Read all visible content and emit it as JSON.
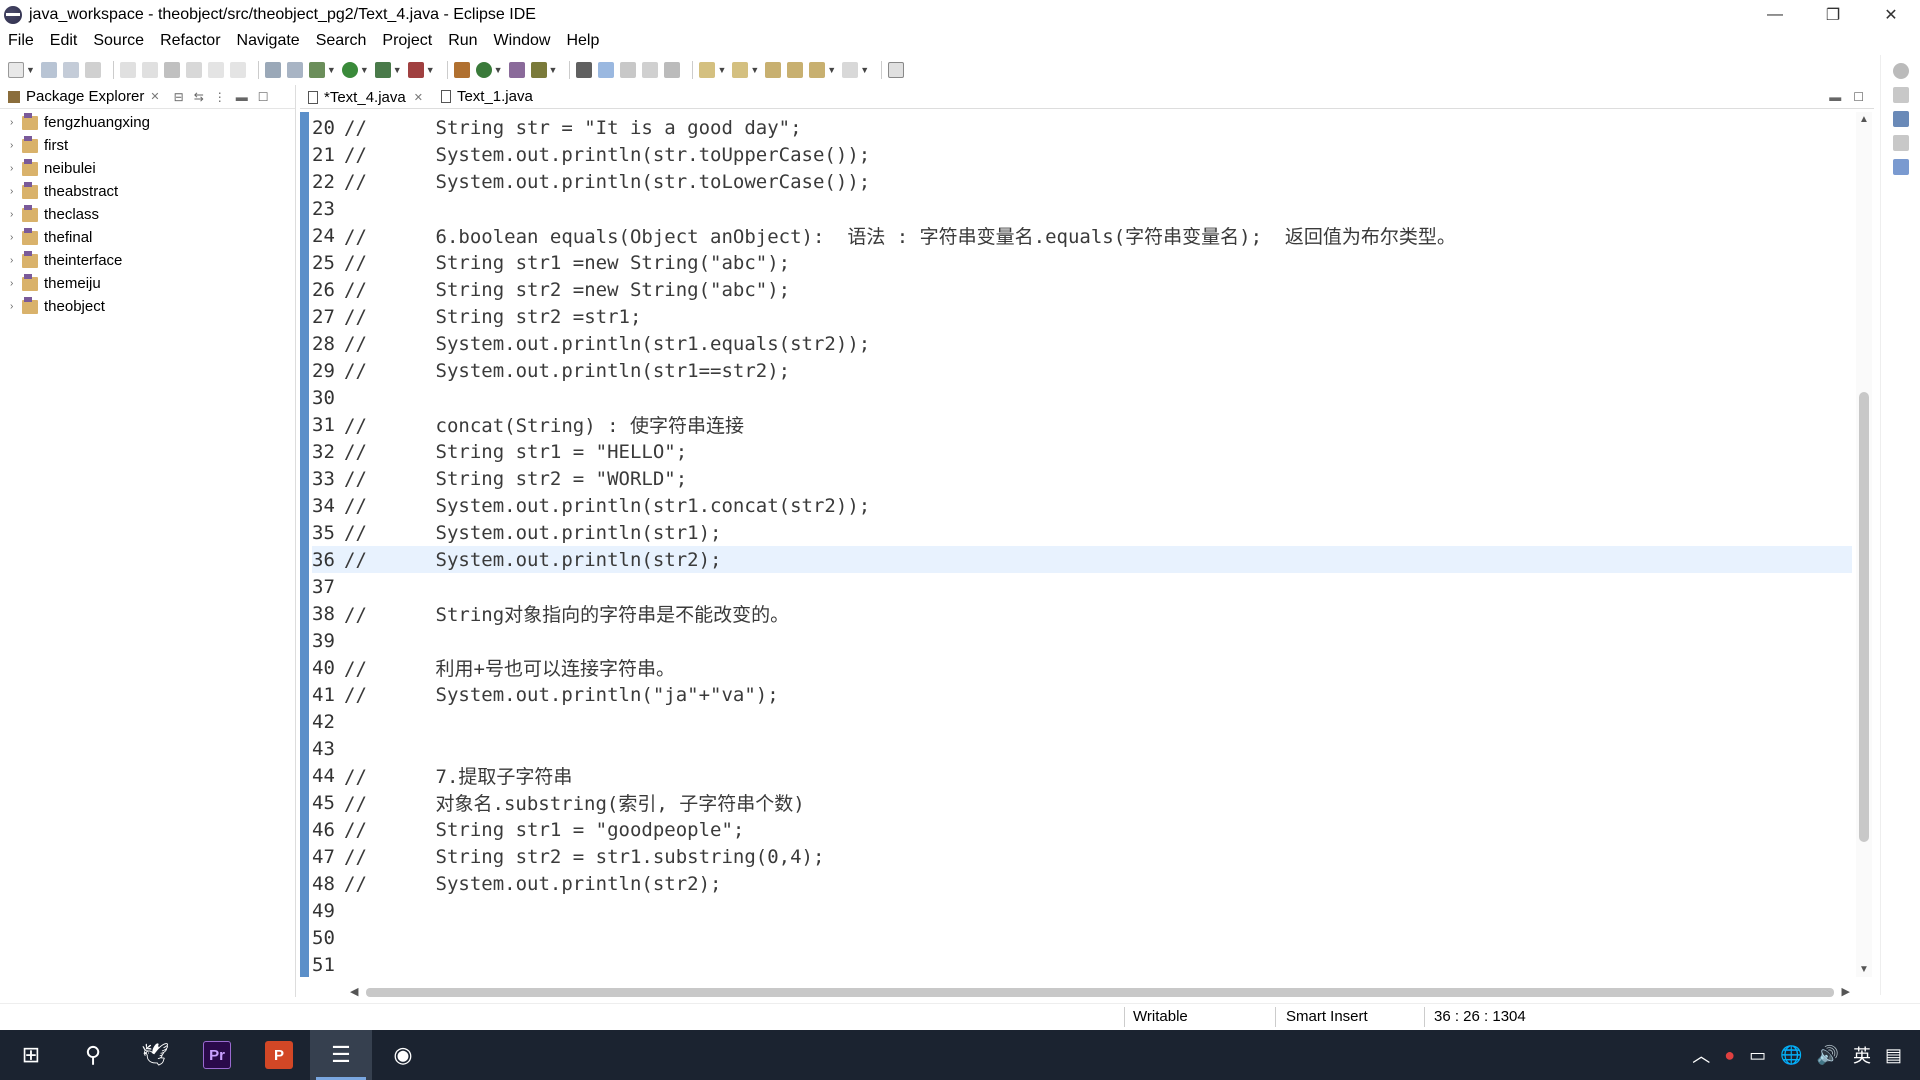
{
  "window": {
    "title": "java_workspace - theobject/src/theobject_pg2/Text_4.java - Eclipse IDE",
    "minimize_glyph": "—",
    "restore_glyph": "❐",
    "close_glyph": "✕"
  },
  "menubar": {
    "items": [
      "File",
      "Edit",
      "Source",
      "Refactor",
      "Navigate",
      "Search",
      "Project",
      "Run",
      "Window",
      "Help"
    ]
  },
  "package_explorer": {
    "title": "Package Explorer",
    "projects": [
      "fengzhuangxing",
      "first",
      "neibulei",
      "theabstract",
      "theclass",
      "thefinal",
      "theinterface",
      "themeiju",
      "theobject"
    ]
  },
  "editor_tabs": [
    {
      "label": "*Text_4.java",
      "active": true
    },
    {
      "label": "Text_1.java",
      "active": false
    }
  ],
  "editor": {
    "current_line": 36,
    "lines": [
      {
        "n": "20",
        "code": "//      String str = \"It is a good day\";"
      },
      {
        "n": "21",
        "code": "//      System.out.println(str.toUpperCase());"
      },
      {
        "n": "22",
        "code": "//      System.out.println(str.toLowerCase());"
      },
      {
        "n": "23",
        "code": ""
      },
      {
        "n": "24",
        "code": "//      6.boolean equals(Object anObject):  语法 : 字符串变量名.equals(字符串变量名);  返回值为布尔类型。"
      },
      {
        "n": "25",
        "code": "//      String str1 =new String(\"abc\");"
      },
      {
        "n": "26",
        "code": "//      String str2 =new String(\"abc\");"
      },
      {
        "n": "27",
        "code": "//      String str2 =str1;"
      },
      {
        "n": "28",
        "code": "//      System.out.println(str1.equals(str2));"
      },
      {
        "n": "29",
        "code": "//      System.out.println(str1==str2);"
      },
      {
        "n": "30",
        "code": ""
      },
      {
        "n": "31",
        "code": "//      concat(String) : 使字符串连接"
      },
      {
        "n": "32",
        "code": "//      String str1 = \"HELLO\";"
      },
      {
        "n": "33",
        "code": "//      String str2 = \"WORLD\";"
      },
      {
        "n": "34",
        "code": "//      System.out.println(str1.concat(str2));"
      },
      {
        "n": "35",
        "code": "//      System.out.println(str1);"
      },
      {
        "n": "36",
        "code": "//      System.out.println(str2);"
      },
      {
        "n": "37",
        "code": ""
      },
      {
        "n": "38",
        "code": "//      String对象指向的字符串是不能改变的。"
      },
      {
        "n": "39",
        "code": ""
      },
      {
        "n": "40",
        "code": "//      利用+号也可以连接字符串。"
      },
      {
        "n": "41",
        "code": "//      System.out.println(\"ja\"+\"va\");"
      },
      {
        "n": "42",
        "code": ""
      },
      {
        "n": "43",
        "code": ""
      },
      {
        "n": "44",
        "code": "//      7.提取子字符串"
      },
      {
        "n": "45",
        "code": "//      对象名.substring(索引, 子字符串个数)"
      },
      {
        "n": "46",
        "code": "//      String str1 = \"goodpeople\";"
      },
      {
        "n": "47",
        "code": "//      String str2 = str1.substring(0,4);"
      },
      {
        "n": "48",
        "code": "//      System.out.println(str2);"
      },
      {
        "n": "49",
        "code": ""
      },
      {
        "n": "50",
        "code": ""
      },
      {
        "n": "51",
        "code": ""
      }
    ]
  },
  "statusbar": {
    "writable": "Writable",
    "insert_mode": "Smart Insert",
    "position": "36 : 26 : 1304"
  },
  "taskbar": {
    "apps": [
      {
        "name": "start",
        "glyph": "⊞"
      },
      {
        "name": "search",
        "glyph": "⚲"
      },
      {
        "name": "bird",
        "glyph": "🕊"
      },
      {
        "name": "premiere",
        "glyph": "Pr"
      },
      {
        "name": "powerpoint",
        "glyph": "P"
      },
      {
        "name": "eclipse",
        "glyph": "☰"
      },
      {
        "name": "obs",
        "glyph": "◉"
      }
    ],
    "tray_ime": "英"
  },
  "colors": {
    "ruler": "#5b8fc9",
    "current_line": "#e8f2fe",
    "taskbar": "#1b2330",
    "premiere": "#2a0a4a",
    "powerpoint": "#d24726"
  }
}
